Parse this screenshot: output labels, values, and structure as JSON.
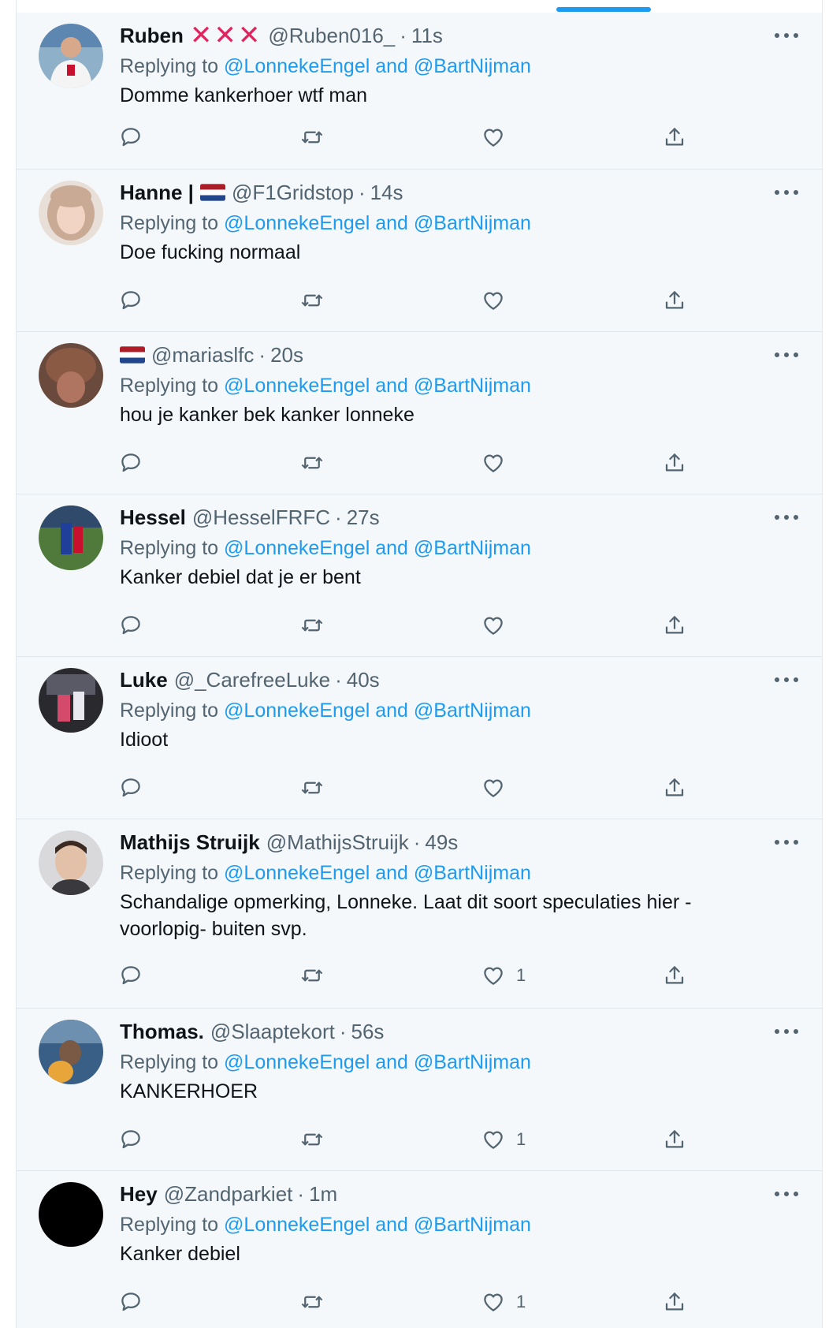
{
  "replying_to_label": "Replying to",
  "mention_1": "@LonnekeEngel",
  "and_word": "and",
  "mention_2": "@BartNijman",
  "tweets": [
    {
      "name": "Ruben",
      "handle": "@Ruben016_",
      "time": "11s",
      "text": "Domme kankerhoer wtf man",
      "likes": ""
    },
    {
      "name": "Hanne |",
      "handle": "@F1Gridstop",
      "time": "14s",
      "text": "Doe fucking normaal",
      "likes": ""
    },
    {
      "name": "",
      "handle": "@mariaslfc",
      "time": "20s",
      "text": "hou je kanker bek kanker lonneke",
      "likes": ""
    },
    {
      "name": "Hessel",
      "handle": "@HesselFRFC",
      "time": "27s",
      "text": "Kanker debiel dat je er bent",
      "likes": ""
    },
    {
      "name": "Luke",
      "handle": "@_CarefreeLuke",
      "time": "40s",
      "text": "Idioot",
      "likes": ""
    },
    {
      "name": "Mathijs Struijk",
      "handle": "@MathijsStruijk",
      "time": "49s",
      "text": "Schandalige opmerking, Lonneke. Laat dit soort speculaties hier -voorlopig- buiten svp.",
      "likes": "1"
    },
    {
      "name": "Thomas.",
      "handle": "@Slaaptekort",
      "time": "56s",
      "text": "KANKERHOER",
      "likes": "1"
    },
    {
      "name": "Hey",
      "handle": "@Zandparkiet",
      "time": "1m",
      "text": "Kanker debiel",
      "likes": "1"
    }
  ],
  "icons": {
    "reply": "reply-icon",
    "retweet": "retweet-icon",
    "like": "heart-icon",
    "share": "share-icon",
    "more": "more-icon",
    "flag": "netherlands-flag-icon",
    "cross": "red-x-icon"
  },
  "colors": {
    "accent": "#1d9bf0",
    "muted": "#536471",
    "tweet_bg": "#f5f8fa",
    "cross": "#e0245e"
  }
}
